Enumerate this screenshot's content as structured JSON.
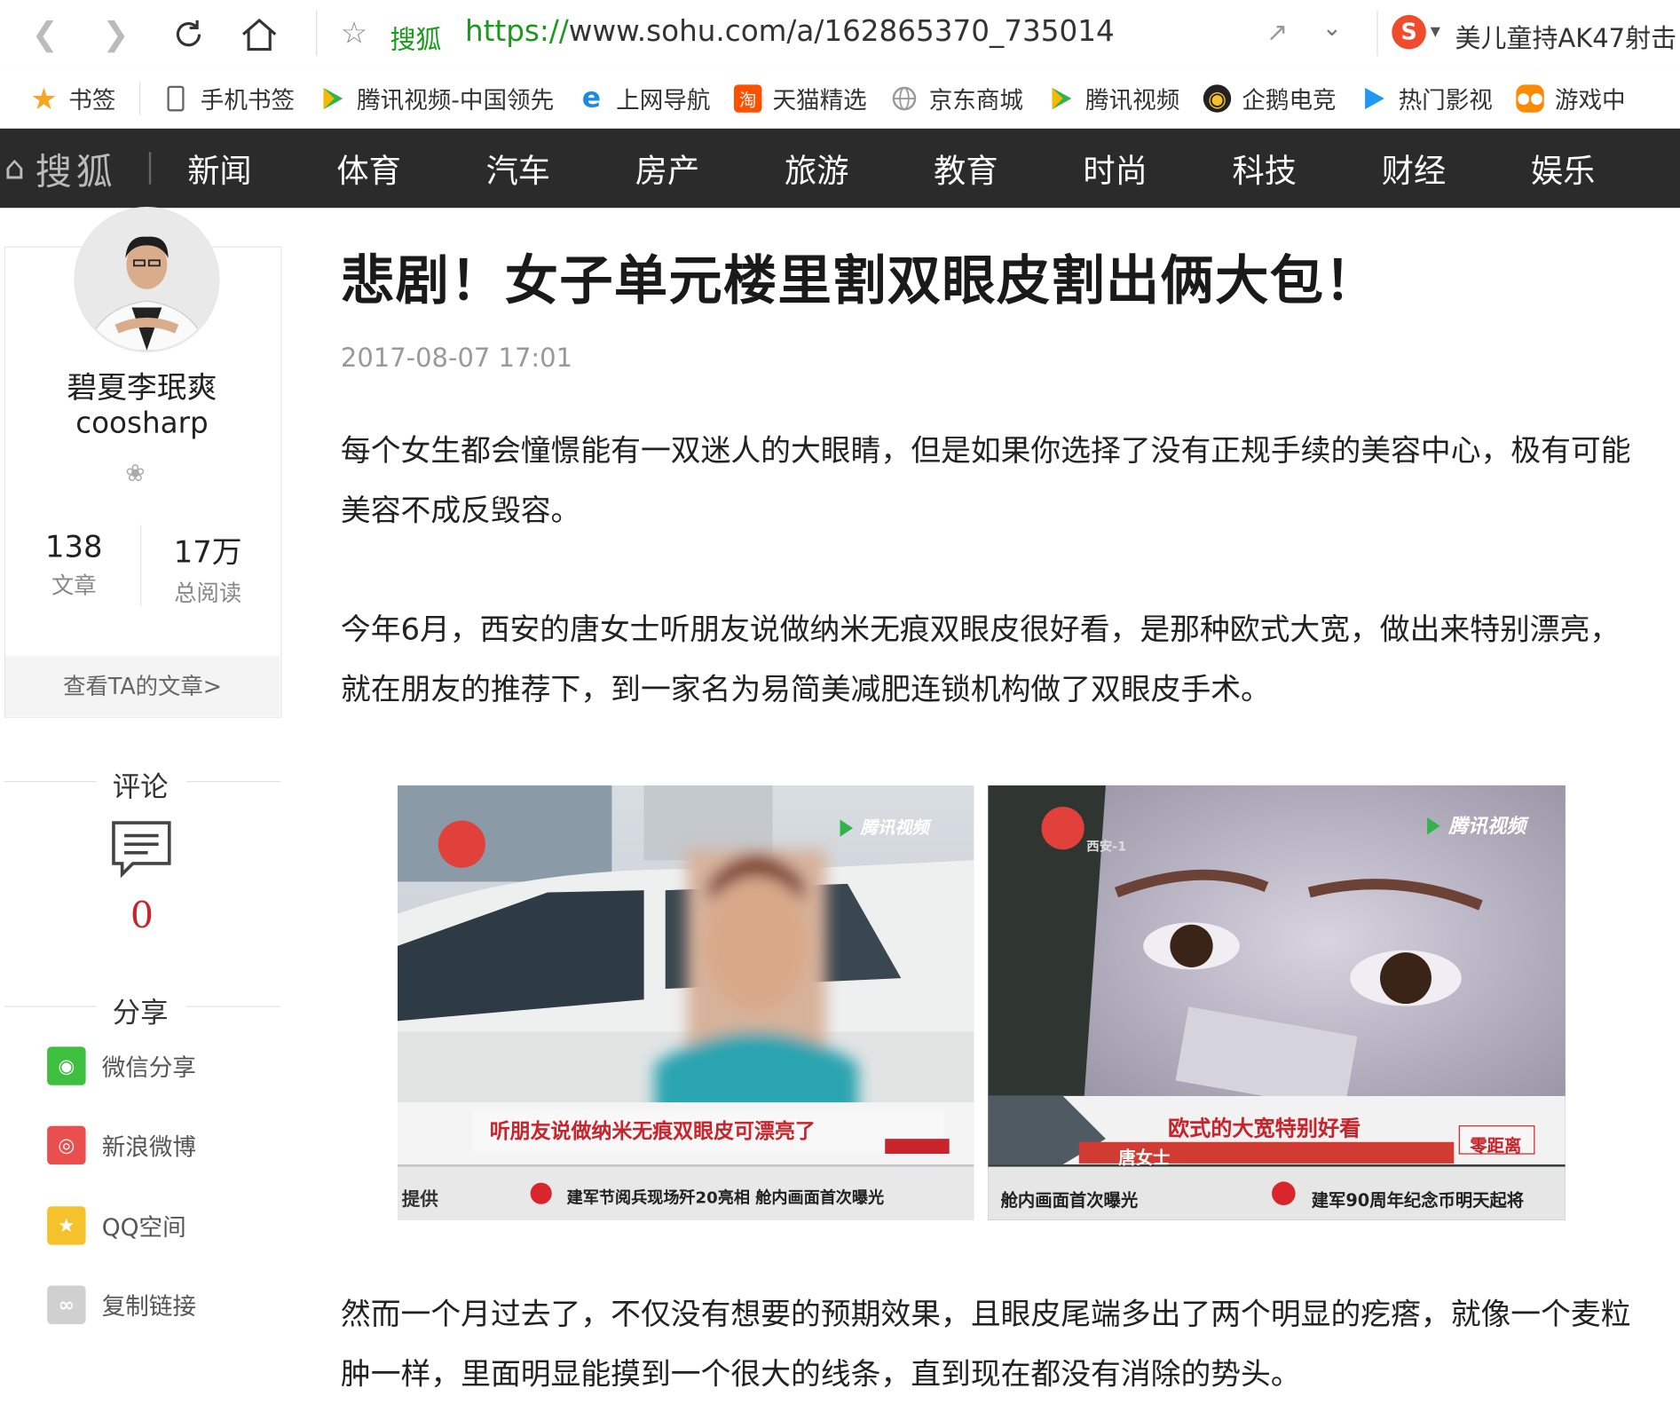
{
  "browser": {
    "site_name": "搜狐",
    "url_scheme": "https://",
    "url_rest": "www.sohu.com/a/162865370_735014",
    "search_engine_letter": "S",
    "hot_search": "美儿童持AK47射击"
  },
  "bookmarks": [
    {
      "label": "书签",
      "icon": "star-icon",
      "color": "#f5a623"
    },
    {
      "label": "手机书签",
      "icon": "phone-icon",
      "color": "#888888"
    },
    {
      "label": "腾讯视频-中国领先",
      "icon": "play-icon",
      "color": "#31b34a"
    },
    {
      "label": "上网导航",
      "icon": "ie-icon",
      "color": "#1e88e5"
    },
    {
      "label": "天猫精选",
      "icon": "tao-icon",
      "color": "#ff5000"
    },
    {
      "label": "京东商城",
      "icon": "globe-icon",
      "color": "#999999"
    },
    {
      "label": "腾讯视频",
      "icon": "play-icon",
      "color": "#31b34a"
    },
    {
      "label": "企鹅电竞",
      "icon": "penguin-icon",
      "color": "#222222"
    },
    {
      "label": "热门影视",
      "icon": "play-icon",
      "color": "#2196f3"
    },
    {
      "label": "游戏中",
      "icon": "gamepad-icon",
      "color": "#ff8a00"
    }
  ],
  "channel_nav": {
    "logo": "搜狐",
    "items": [
      "新闻",
      "体育",
      "汽车",
      "房产",
      "旅游",
      "教育",
      "时尚",
      "科技",
      "财经",
      "娱乐"
    ]
  },
  "author": {
    "name_cn": "碧夏李珉爽",
    "name_en": "coosharp",
    "articles_count": "138",
    "articles_label": "文章",
    "reads_count": "17万",
    "reads_label": "总阅读",
    "view_articles": "查看TA的文章>"
  },
  "comments": {
    "title": "评论",
    "count": "0"
  },
  "share": {
    "title": "分享",
    "items": [
      {
        "label": "微信分享",
        "color": "#3fbf3f"
      },
      {
        "label": "新浪微博",
        "color": "#e94f4f"
      },
      {
        "label": "QQ空间",
        "color": "#f6c22c"
      },
      {
        "label": "复制链接",
        "color": "#d0d0d0"
      }
    ]
  },
  "article": {
    "title": "悲剧！女子单元楼里割双眼皮割出俩大包！",
    "date": "2017-08-07 17:01",
    "paragraphs": [
      "每个女生都会憧憬能有一双迷人的大眼睛，但是如果你选择了没有正规手续的美容中心，极有可能美容不成反毁容。",
      "今年6月，西安的唐女士听朋友说做纳米无痕双眼皮很好看，是那种欧式大宽，做出来特别漂亮，就在朋友的推荐下，到一家名为易简美减肥连锁机构做了双眼皮手术。",
      "然而一个月过去了，不仅没有想要的预期效果，且眼皮尾端多出了两个明显的疙瘩，就像一个麦粒肿一样，里面明显能摸到一个很大的线条，直到现在都没有消除的势头。"
    ],
    "image_left": {
      "caption": "听朋友说做纳米无痕双眼皮可漂亮了",
      "ticker": "建军节阅兵现场歼20亮相  舱内画面首次曝光",
      "ticker_left": "提供",
      "watermark": "腾讯视频"
    },
    "image_right": {
      "caption": "欧式的大宽特别好看",
      "name_tag": "唐女士",
      "badge": "零距离",
      "ticker": "建军90周年纪念币明天起将",
      "ticker_left": "舱内画面首次曝光",
      "watermark": "腾讯视频",
      "station": "西安-1"
    }
  }
}
